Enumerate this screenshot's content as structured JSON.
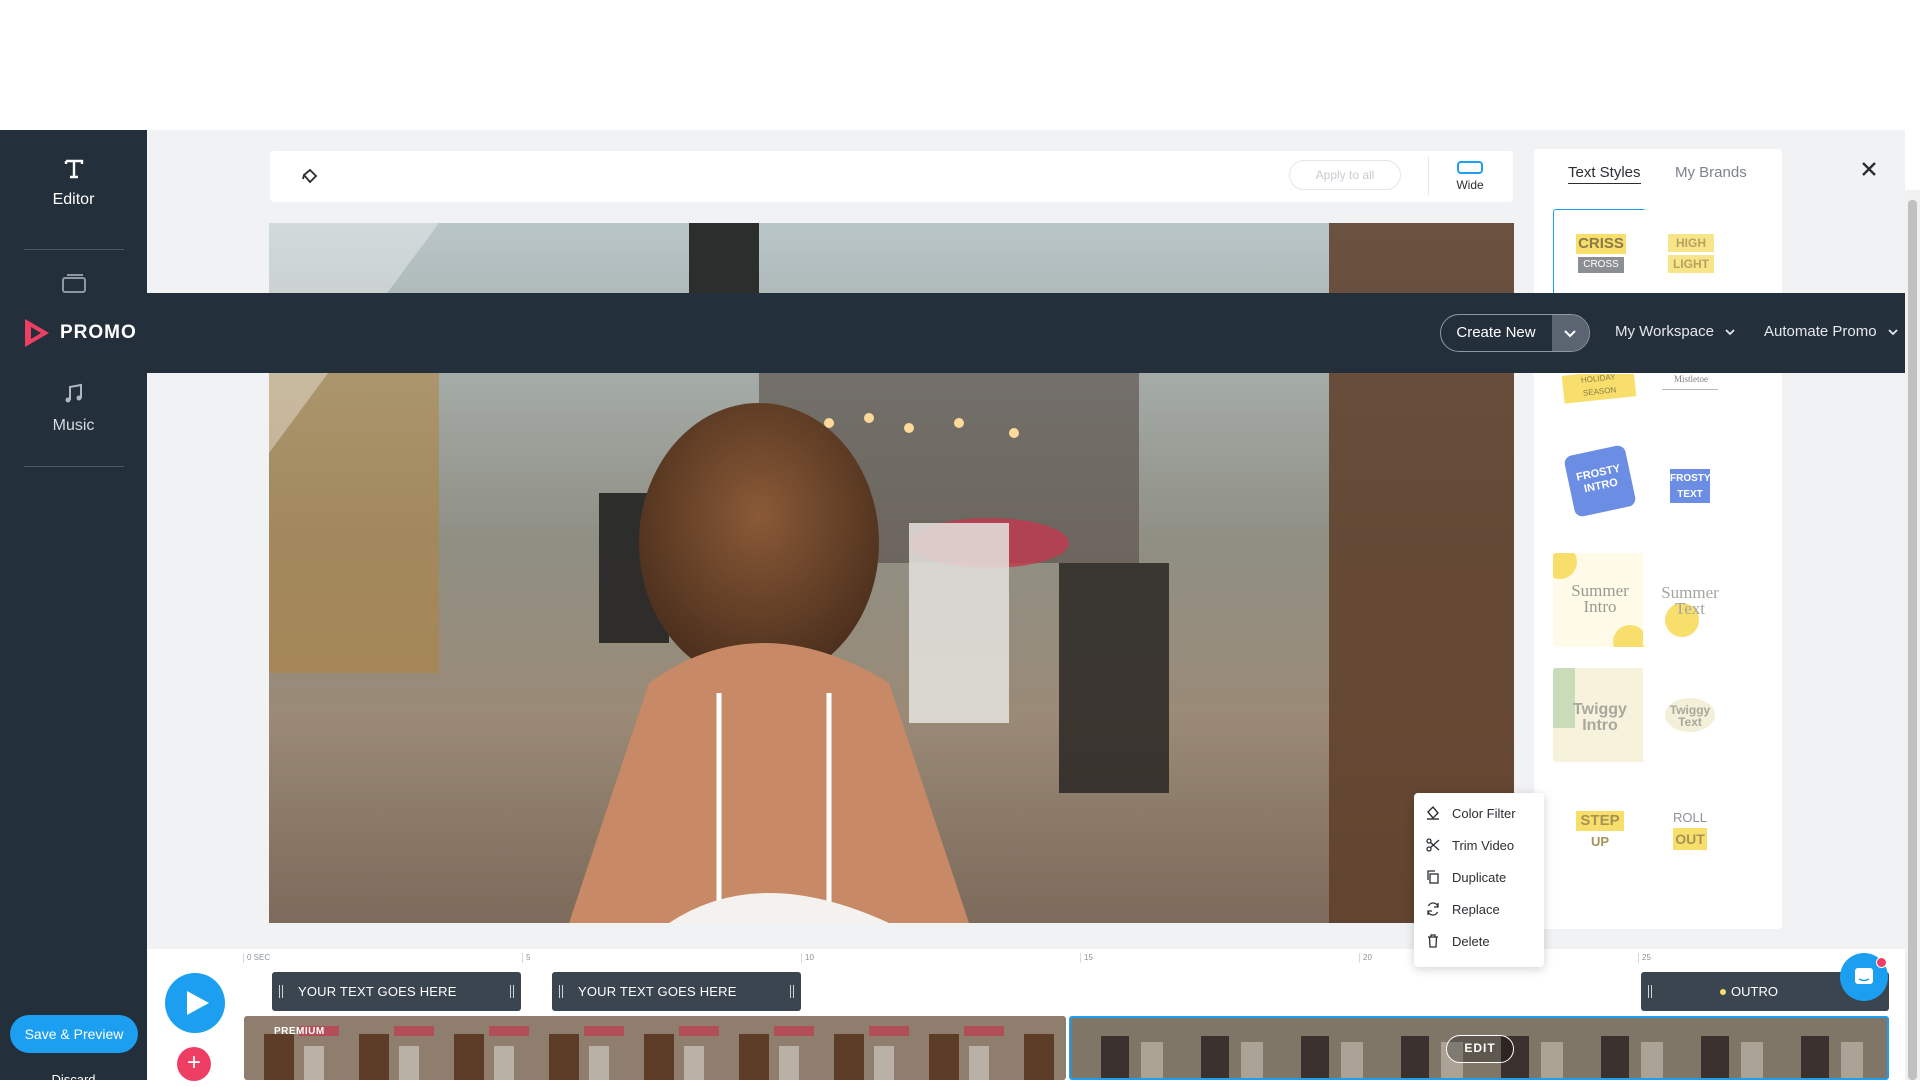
{
  "sidebar": {
    "items": [
      {
        "label": "Editor",
        "icon": "text-icon"
      },
      {
        "label": "",
        "icon": "media-icon"
      },
      {
        "label": "Music",
        "icon": "music-icon"
      }
    ],
    "save_label": "Save & Preview",
    "discard_label": "Discard"
  },
  "navbar": {
    "logo_text": "PROMO",
    "create_new_label": "Create New",
    "menus": [
      "My Workspace",
      "Automate Promo"
    ]
  },
  "toolbar": {
    "apply_label": "Apply to all",
    "wide_label": "Wide"
  },
  "right_panel": {
    "tabs": [
      "Text Styles",
      "My Brands"
    ],
    "active_tab": "Text Styles",
    "styles": [
      {
        "name": "criss-cross",
        "lines": [
          "CRISS",
          "CROSS"
        ]
      },
      {
        "name": "high-light",
        "lines": [
          "HIGH",
          "LIGHT"
        ]
      },
      {
        "name": "holiday-season",
        "lines": [
          "HOLIDAY",
          "SEASON"
        ]
      },
      {
        "name": "mistletoe",
        "lines": [
          "Mistletoe"
        ]
      },
      {
        "name": "frosty-intro",
        "lines": [
          "FROSTY",
          "INTRO"
        ]
      },
      {
        "name": "frosty-text",
        "lines": [
          "FROSTY",
          "TEXT"
        ]
      },
      {
        "name": "summer-intro",
        "lines": [
          "Summer",
          "Intro"
        ]
      },
      {
        "name": "summer-text",
        "lines": [
          "Summer",
          "Text"
        ]
      },
      {
        "name": "twiggy-intro",
        "lines": [
          "Twiggy",
          "Intro"
        ]
      },
      {
        "name": "twiggy-text",
        "lines": [
          "Twiggy",
          "Text"
        ]
      },
      {
        "name": "step-up",
        "lines": [
          "STEP",
          "UP"
        ]
      },
      {
        "name": "roll-out",
        "lines": [
          "ROLL",
          "OUT"
        ]
      }
    ]
  },
  "context_menu": {
    "items": [
      {
        "label": "Color Filter",
        "icon": "color-filter-icon"
      },
      {
        "label": "Trim Video",
        "icon": "scissors-icon"
      },
      {
        "label": "Duplicate",
        "icon": "duplicate-icon"
      },
      {
        "label": "Replace",
        "icon": "replace-icon"
      },
      {
        "label": "Delete",
        "icon": "trash-icon"
      }
    ]
  },
  "timeline": {
    "ticks": [
      "0 SEC",
      "5",
      "10",
      "15",
      "20",
      "25"
    ],
    "text_clips": [
      "YOUR TEXT GOES HERE",
      "YOUR TEXT GOES HERE"
    ],
    "outro_label": "OUTRO",
    "premium_badge": "PREMIUM",
    "edit_label": "EDIT"
  },
  "colors": {
    "accent": "#1c9ff0",
    "dark": "#232f3a",
    "brand_pink": "#ee3e63",
    "style_yellow": "#f8de6b"
  }
}
